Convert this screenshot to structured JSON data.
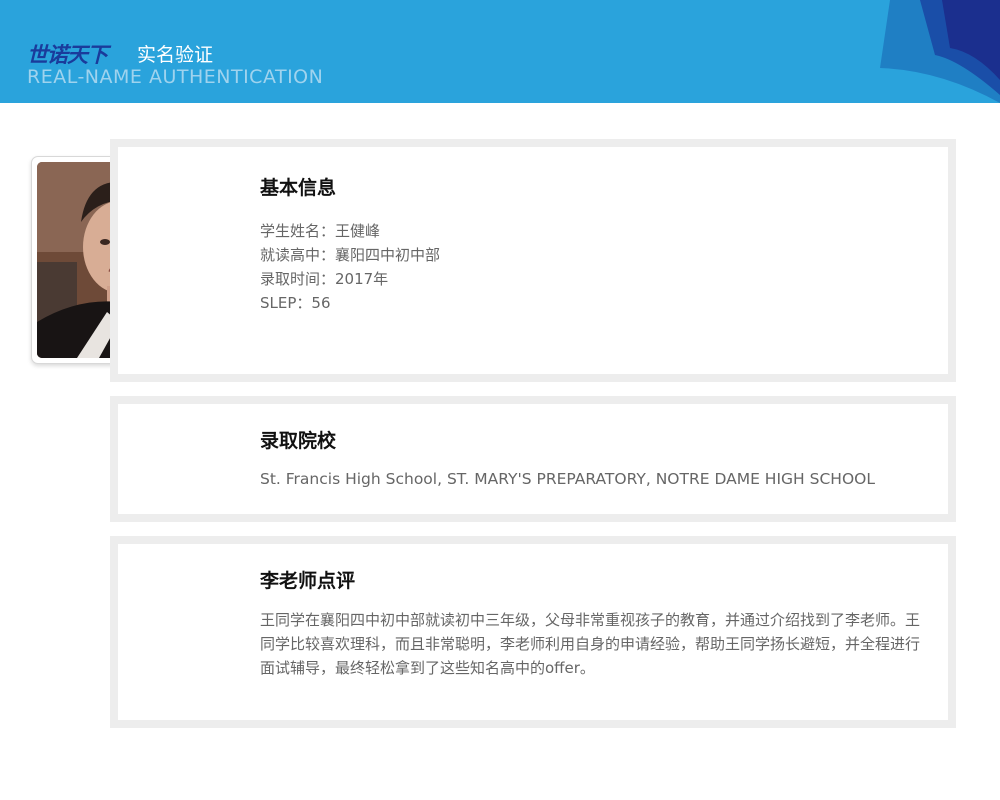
{
  "header": {
    "brand": "世诺天下",
    "title": "实名验证",
    "subtitle_en": "REAL-NAME AUTHENTICATION"
  },
  "basic_info": {
    "heading": "基本信息",
    "rows": [
      "学生姓名：王健峰",
      "就读高中：襄阳四中初中部",
      "录取时间：2017年",
      "SLEP：56"
    ]
  },
  "admission": {
    "heading": "录取院校",
    "schools": "St. Francis High School, ST. MARY'S PREPARATORY, NOTRE DAME HIGH SCHOOL"
  },
  "review": {
    "heading": "李老师点评",
    "text": "王同学在襄阳四中初中部就读初中三年级，父母非常重视孩子的教育，并通过介绍找到了李老师。王同学比较喜欢理科，而且非常聪明，李老师利用自身的申请经验，帮助王同学扬长避短，并全程进行面试辅导，最终轻松拿到了这些知名高中的offer。"
  },
  "colors": {
    "header_bg": "#2aa3dc",
    "brand": "#1a3b9b",
    "card_border": "#ededed",
    "body_text": "#666666"
  }
}
